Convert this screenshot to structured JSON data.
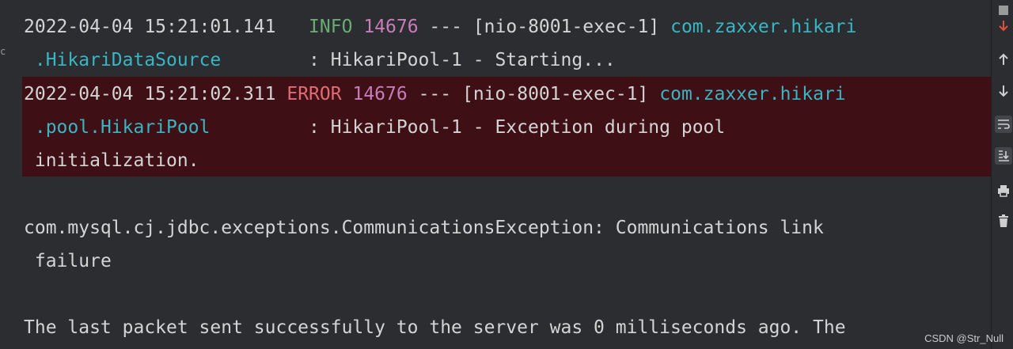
{
  "console": {
    "log1": {
      "timestamp": "2022-04-04 15:21:01.141",
      "level": " INFO",
      "pid": "14676",
      "sep": "---",
      "thread": "[nio-8001-exec-1]",
      "logger_a": "com.zaxxer.hikari",
      "logger_b": ".HikariDataSource",
      "message": ": HikariPool-1 - Starting..."
    },
    "log2": {
      "timestamp": "2022-04-04 15:21:02.311",
      "level": "ERROR",
      "pid": "14676",
      "sep": "---",
      "thread": "[nio-8001-exec-1]",
      "logger_a": "com.zaxxer.hikari",
      "logger_b": ".pool.HikariPool",
      "message": ": HikariPool-1 - Exception during pool",
      "message_cont": "initialization."
    },
    "exception_line": "com.mysql.cj.jdbc.exceptions.CommunicationsException: Communications link",
    "exception_cont": "failure",
    "last_line": "The last packet sent successfully to the server was 0 milliseconds ago. The"
  },
  "toolbar": {
    "icons": [
      "stop-icon",
      "arrow-up-icon",
      "arrow-down-icon",
      "soft-wrap-icon",
      "scroll-to-end-icon",
      "print-icon",
      "trash-icon"
    ]
  },
  "watermark": "CSDN @Str_Null",
  "colors": {
    "background": "#2b2d30",
    "error_background": "#3e0f14",
    "info": "#6aab73",
    "error": "#e06c75",
    "pid": "#c77dbb",
    "logger": "#38b6c4"
  }
}
